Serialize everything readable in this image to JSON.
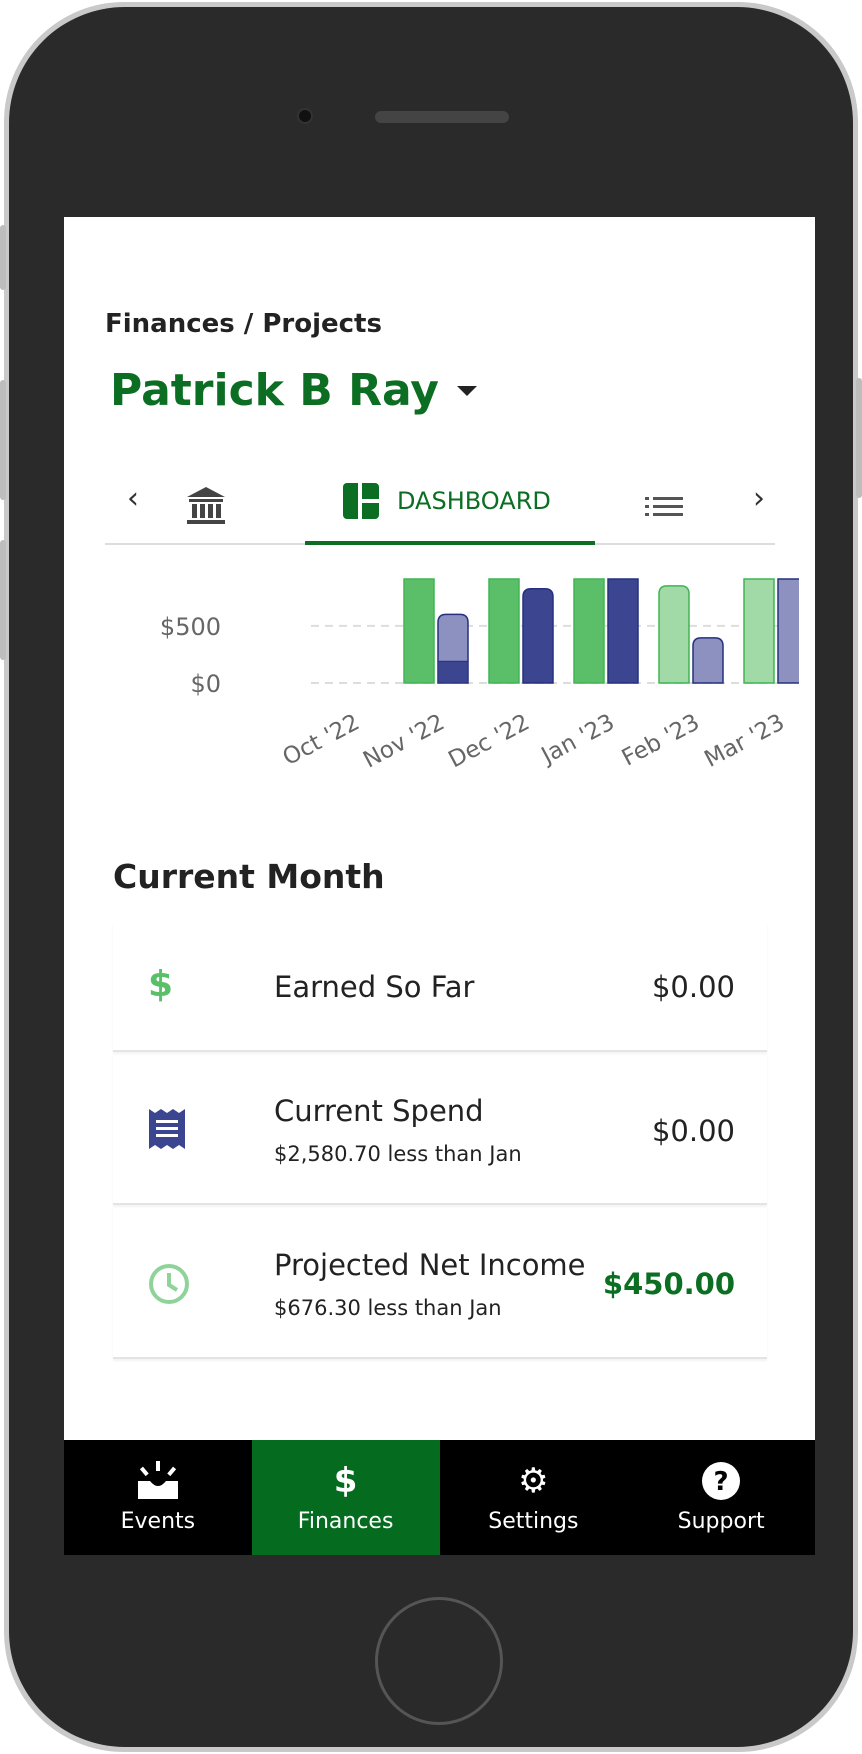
{
  "header": {
    "breadcrumb": "Finances / Projects",
    "client_name": "Patrick B Ray"
  },
  "tabs": {
    "items": [
      {
        "icon": "bank-icon",
        "label": ""
      },
      {
        "icon": "dashboard-icon",
        "label": "DASHBOARD",
        "active": true
      },
      {
        "icon": "list-icon",
        "label": ""
      }
    ]
  },
  "chart_data": {
    "type": "bar",
    "categories": [
      "Oct '22",
      "Nov '22",
      "Dec '22",
      "Jan '23",
      "Feb '23",
      "Mar '23"
    ],
    "yticks": [
      "$0",
      "$500"
    ],
    "ylim": [
      0,
      910
    ],
    "grid": true,
    "series": [
      {
        "color": "#5bbf6a",
        "values": [
          0,
          1000,
          1000,
          1000,
          850,
          1000
        ],
        "light_from_index": 4
      },
      {
        "color": "#3b4590",
        "values": [
          0,
          600,
          825,
          1000,
          395,
          1000
        ],
        "light_from_index": 4,
        "nov_dark_portion": 190
      }
    ]
  },
  "current_month": {
    "title": "Current Month",
    "items": [
      {
        "icon": "dollar-icon",
        "label": "Earned So Far",
        "sub": "",
        "value": "$0.00",
        "color": "#5bbf6a"
      },
      {
        "icon": "receipt-icon",
        "label": "Current Spend",
        "sub": "$2,580.70 less than Jan",
        "value": "$0.00",
        "color": "#3b4590"
      },
      {
        "icon": "clock-icon",
        "label": "Projected Net Income",
        "sub": "$676.30 less than Jan",
        "value": "$450.00",
        "color": "#8fd39a",
        "value_color": "#0b6e22"
      }
    ]
  },
  "nav": {
    "items": [
      {
        "label": "Events",
        "icon": "events-icon"
      },
      {
        "label": "Finances",
        "icon": "dollar-icon",
        "active": true
      },
      {
        "label": "Settings",
        "icon": "gear-icon"
      },
      {
        "label": "Support",
        "icon": "help-icon"
      }
    ]
  }
}
